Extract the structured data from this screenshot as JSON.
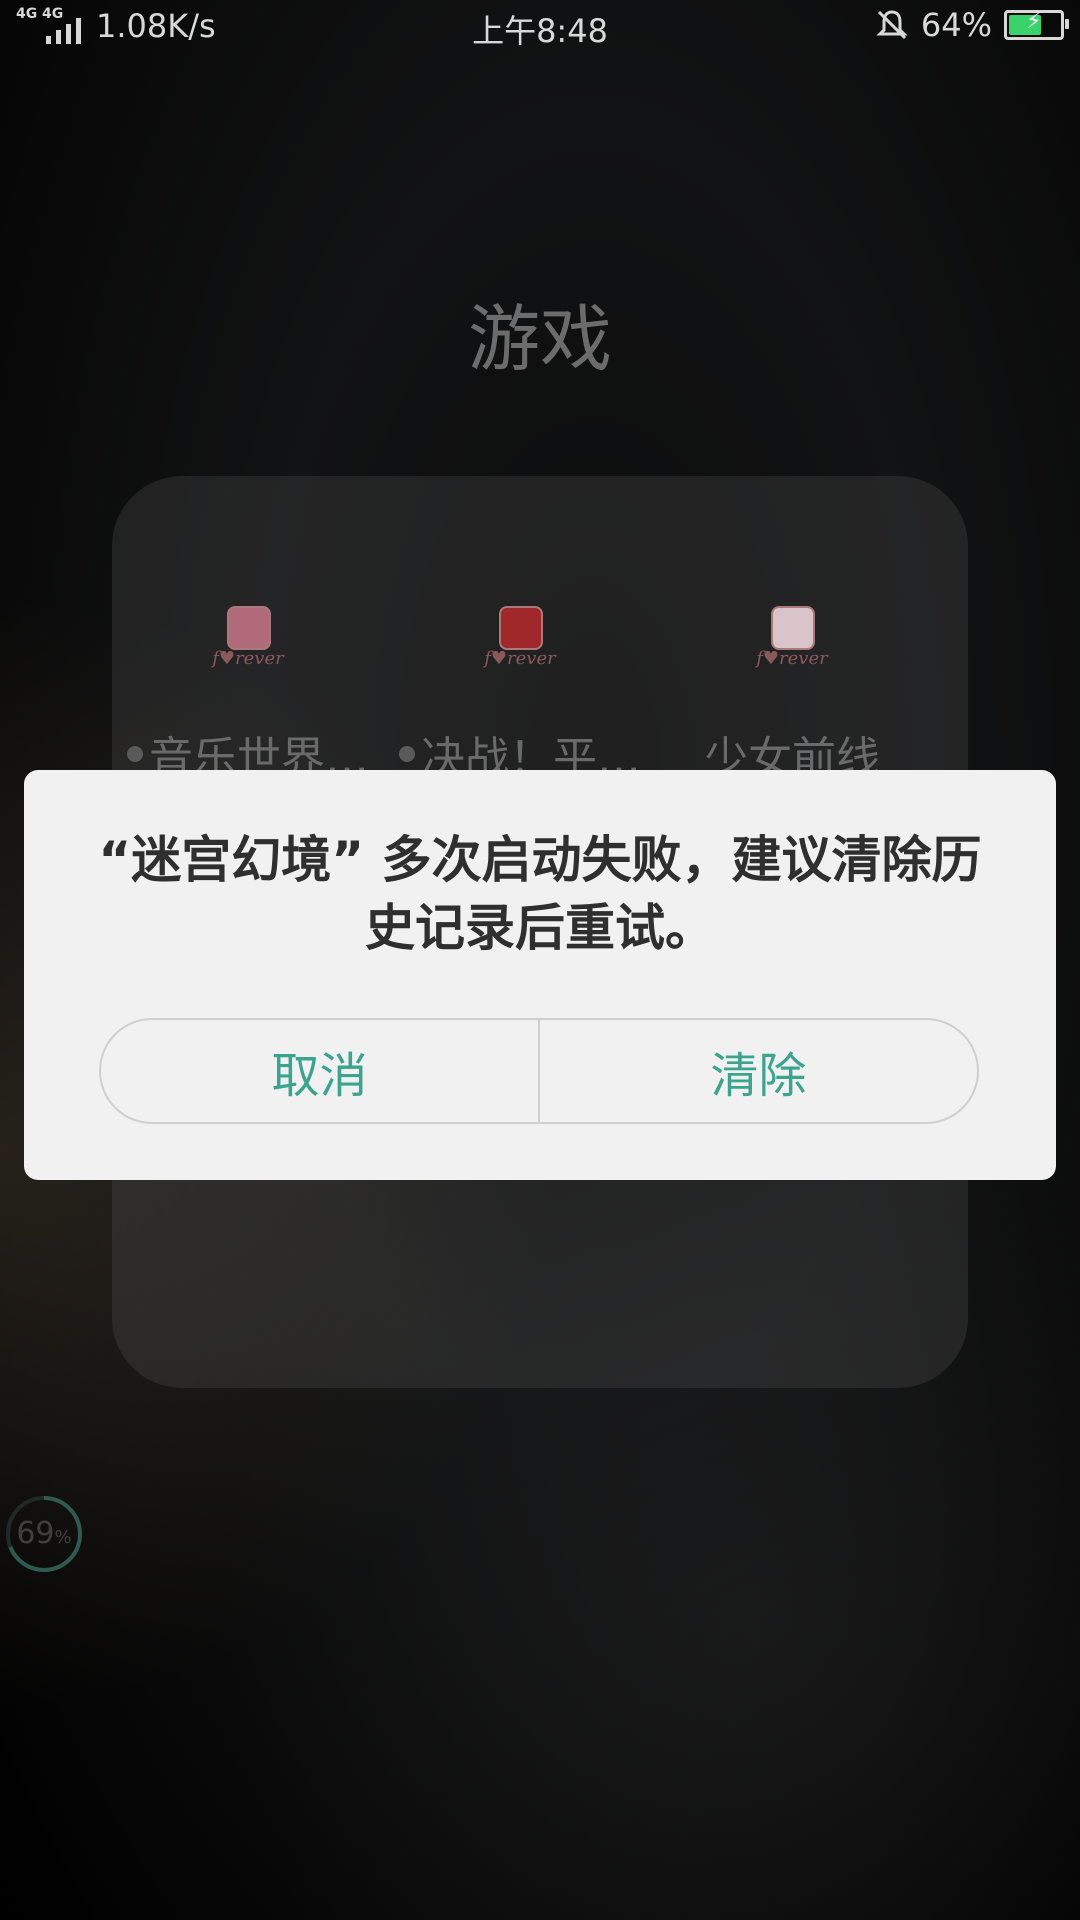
{
  "status_bar": {
    "network_1": "4G",
    "network_2": "4G",
    "speed": "1.08K/s",
    "time": "上午8:48",
    "battery": "64%",
    "battery_level": 0.64,
    "battery_color": "#3ad26a"
  },
  "folder": {
    "title": "游戏",
    "apps": [
      {
        "name": "音乐世界…",
        "icon": "game-icon",
        "caption": "f♥rever",
        "dot": true
      },
      {
        "name": "决战！平…",
        "icon": "game-icon",
        "caption": "f♥rever",
        "dot": true
      },
      {
        "name": "少女前线",
        "icon": "game-icon",
        "caption": "f♥rever",
        "dot": false
      }
    ]
  },
  "dialog": {
    "message_line1": "“迷宫幻境” 多次启动失败，建议清除历",
    "message_line2": "史记录后重试。",
    "cancel_label": "取消",
    "clear_label": "清除",
    "accent_color": "#3aa58e"
  },
  "memory_widget": {
    "value": "69",
    "unit": "%",
    "level": 0.69
  }
}
